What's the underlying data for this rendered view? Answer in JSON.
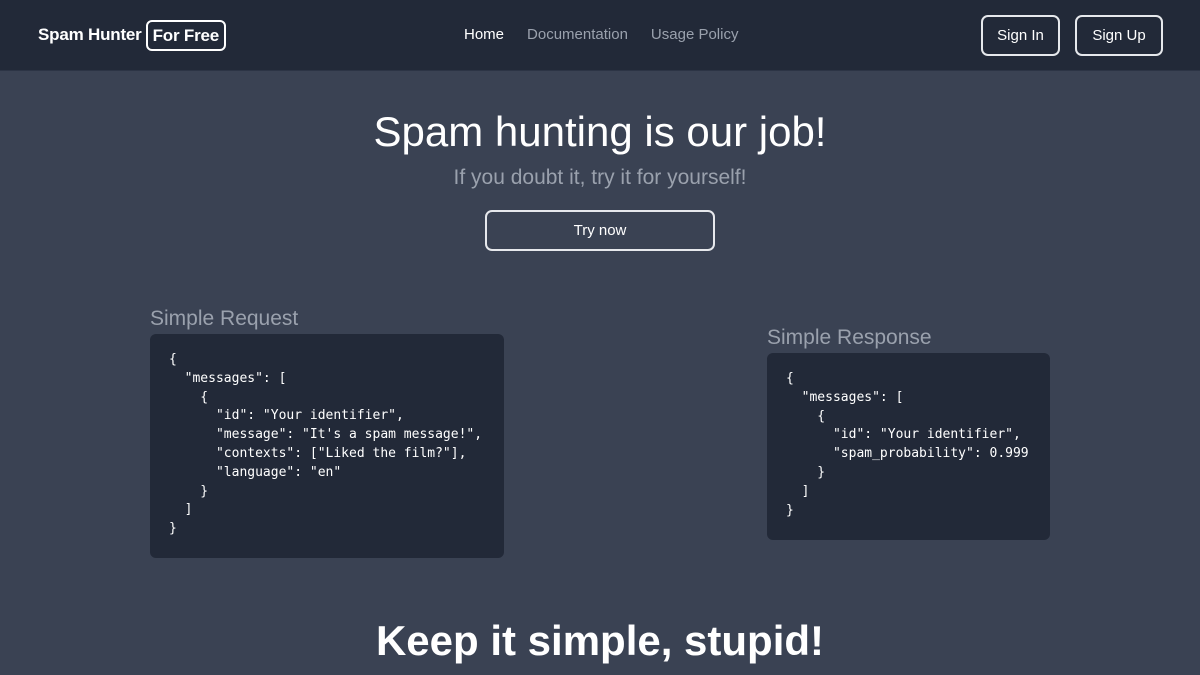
{
  "navbar": {
    "brand_name": "Spam Hunter",
    "brand_badge": "For Free",
    "links": [
      {
        "label": "Home"
      },
      {
        "label": "Documentation"
      },
      {
        "label": "Usage Policy"
      }
    ],
    "sign_in": "Sign In",
    "sign_up": "Sign Up"
  },
  "hero": {
    "title": "Spam hunting is our job!",
    "subtitle": "If you doubt it, try it for yourself!",
    "cta": "Try now"
  },
  "request": {
    "label": "Simple Request",
    "code": [
      "{",
      "  \"messages\": [",
      "    {",
      "      \"id\": \"Your identifier\",",
      "      \"message\": \"It's a spam message!\",",
      "      \"contexts\": [\"Liked the film?\"],",
      "      \"language\": \"en\"",
      "    }",
      "  ]",
      "}"
    ]
  },
  "response": {
    "label": "Simple Response",
    "code": [
      "{",
      "  \"messages\": [",
      "    {",
      "      \"id\": \"Your identifier\",",
      "      \"spam_probability\": 0.999",
      "    }",
      "  ]",
      "}"
    ]
  },
  "bottom": {
    "title": "Keep it simple, stupid!"
  }
}
